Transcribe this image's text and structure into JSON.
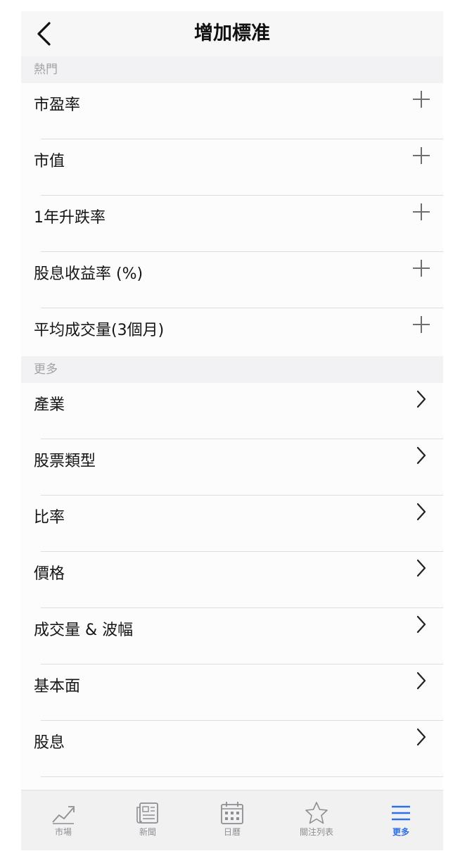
{
  "header": {
    "title": "增加標准"
  },
  "sections": [
    {
      "label": "熱門",
      "items": [
        {
          "label": "市盈率",
          "action": "add"
        },
        {
          "label": "市值",
          "action": "add"
        },
        {
          "label": "1年升跌率",
          "action": "add"
        },
        {
          "label": "股息收益率 (%)",
          "action": "add"
        },
        {
          "label": "平均成交量(3個月)",
          "action": "add"
        }
      ]
    },
    {
      "label": "更多",
      "items": [
        {
          "label": "產業",
          "action": "navigate"
        },
        {
          "label": "股票類型",
          "action": "navigate"
        },
        {
          "label": "比率",
          "action": "navigate"
        },
        {
          "label": "價格",
          "action": "navigate"
        },
        {
          "label": "成交量 & 波幅",
          "action": "navigate"
        },
        {
          "label": "基本面",
          "action": "navigate"
        },
        {
          "label": "股息",
          "action": "navigate"
        }
      ]
    }
  ],
  "tabbar": {
    "items": [
      {
        "label": "市場",
        "icon": "chart-icon"
      },
      {
        "label": "新聞",
        "icon": "news-icon"
      },
      {
        "label": "日曆",
        "icon": "calendar-icon"
      },
      {
        "label": "關注列表",
        "icon": "star-icon"
      },
      {
        "label": "更多",
        "icon": "menu-icon",
        "active": true
      }
    ]
  },
  "colors": {
    "accent": "#2f6fe6",
    "icon_gray": "#6e6e73",
    "text": "#151515"
  }
}
